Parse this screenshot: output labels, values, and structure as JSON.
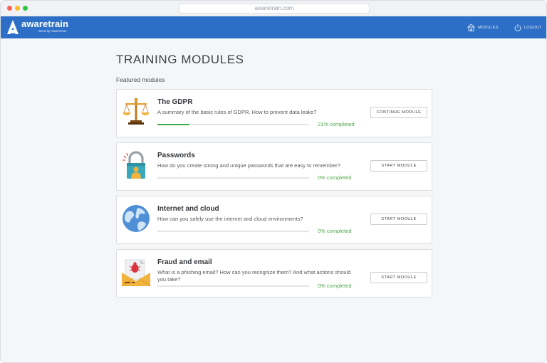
{
  "browser": {
    "url": "awaretrain.com"
  },
  "header": {
    "brand": "awaretrain",
    "tagline": "Security Awareness",
    "nav": [
      {
        "label": "MODULES",
        "icon": "home-icon"
      },
      {
        "label": "LOGOUT",
        "icon": "power-icon"
      }
    ]
  },
  "page": {
    "title": "TRAINING MODULES",
    "section": "Featured modules"
  },
  "modules": [
    {
      "title": "The GDPR",
      "description": "A summary of the basic rules of GDPR. How to prevent data leaks?",
      "progress_percent": 21,
      "progress_text": "21% completed",
      "button": "CONTINUE MODULE",
      "icon": "scales-icon"
    },
    {
      "title": "Passwords",
      "description": "How do you create strong and unique passwords that are easy to remember?",
      "progress_percent": 0,
      "progress_text": "0% completed",
      "button": "START MODULE",
      "icon": "padlock-icon"
    },
    {
      "title": "Internet and cloud",
      "description": "How can you safely use the internet and cloud environments?",
      "progress_percent": 0,
      "progress_text": "0% completed",
      "button": "START MODULE",
      "icon": "globe-icon"
    },
    {
      "title": "Fraud and email",
      "description": "What is a phishing email? How can you recognize them? And what actions should you take?",
      "progress_percent": 0,
      "progress_text": "0% completed",
      "button": "START MODULE",
      "icon": "phishing-envelope-icon"
    }
  ],
  "colors": {
    "header": "#2d6fc6",
    "progress": "#3aaa49",
    "progress_text": "#4ea74c"
  }
}
